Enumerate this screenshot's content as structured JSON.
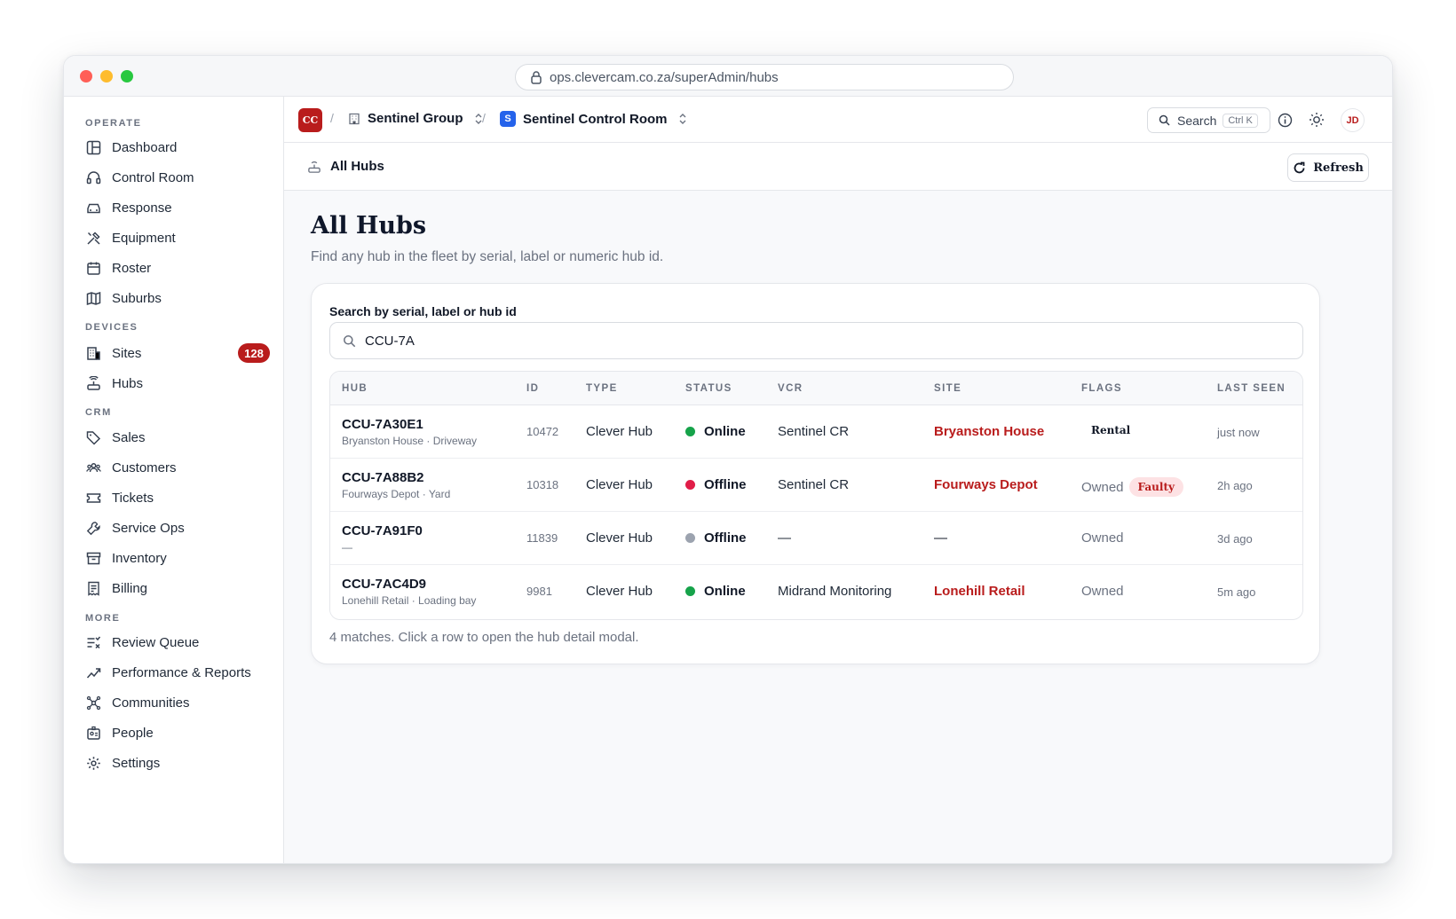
{
  "browser": {
    "url": "ops.clevercam.co.za/superAdmin/hubs"
  },
  "sidebar": {
    "sections": {
      "operate": "OPERATE",
      "devices": "DEVICES",
      "crm": "CRM",
      "more": "MORE"
    },
    "items": {
      "dashboard": "Dashboard",
      "control_room": "Control Room",
      "response": "Response",
      "equipment": "Equipment",
      "roster": "Roster",
      "suburbs": "Suburbs",
      "sites": "Sites",
      "sites_badge": "128",
      "hubs": "Hubs",
      "sales": "Sales",
      "customers": "Customers",
      "tickets": "Tickets",
      "service_ops": "Service Ops",
      "inventory": "Inventory",
      "billing": "Billing",
      "review_queue": "Review Queue",
      "performance_reports": "Performance & Reports",
      "communities": "Communities",
      "people": "People",
      "settings": "Settings"
    }
  },
  "topbar": {
    "brand": "CC",
    "separator": "/",
    "org": "Sentinel Group",
    "room_initial": "S",
    "room": "Sentinel Control Room",
    "search_label": "Search",
    "search_shortcut": "Ctrl K",
    "avatar": "JD"
  },
  "subbar": {
    "title": "All Hubs",
    "refresh": "Refresh"
  },
  "page": {
    "title": "All Hubs",
    "subtitle": "Find any hub in the fleet by serial, label or numeric hub id."
  },
  "search": {
    "label": "Search by serial, label or hub id",
    "value": "CCU-7A"
  },
  "table": {
    "headers": {
      "hub": "HUB",
      "id": "ID",
      "type": "TYPE",
      "status": "STATUS",
      "vcr": "VCR",
      "site": "SITE",
      "flags": "FLAGS",
      "last_seen": "LAST SEEN"
    },
    "rows": [
      {
        "serial": "CCU-7A30E1",
        "label": "Bryanston House · Driveway",
        "id": "10472",
        "type": "Clever Hub",
        "status": "Online",
        "status_color": "#16a34a",
        "vcr": "Sentinel CR",
        "site": "Bryanston House",
        "ownership": "",
        "flag": "Rental",
        "last_seen": "just now"
      },
      {
        "serial": "CCU-7A88B2",
        "label": "Fourways Depot · Yard",
        "id": "10318",
        "type": "Clever Hub",
        "status": "Offline",
        "status_color": "#e11d48",
        "vcr": "Sentinel CR",
        "site": "Fourways Depot",
        "ownership": "Owned",
        "flag": "Faulty",
        "last_seen": "2h ago"
      },
      {
        "serial": "CCU-7A91F0",
        "label": "—",
        "id": "11839",
        "type": "Clever Hub",
        "status": "Offline",
        "status_color": "#9ca3af",
        "vcr": "—",
        "site": "—",
        "ownership": "Owned",
        "flag": "",
        "last_seen": "3d ago"
      },
      {
        "serial": "CCU-7AC4D9",
        "label": "Lonehill Retail · Loading bay",
        "id": "9981",
        "type": "Clever Hub",
        "status": "Online",
        "status_color": "#16a34a",
        "vcr": "Midrand Monitoring",
        "site": "Lonehill Retail",
        "ownership": "Owned",
        "flag": "",
        "last_seen": "5m ago"
      }
    ]
  },
  "footer_note": "4 matches. Click a row to open the hub detail modal.",
  "colors": {
    "accent": "#b91c1c",
    "online": "#16a34a",
    "offline": "#e11d48",
    "unknown": "#9ca3af",
    "room_badge": "#2563eb"
  }
}
